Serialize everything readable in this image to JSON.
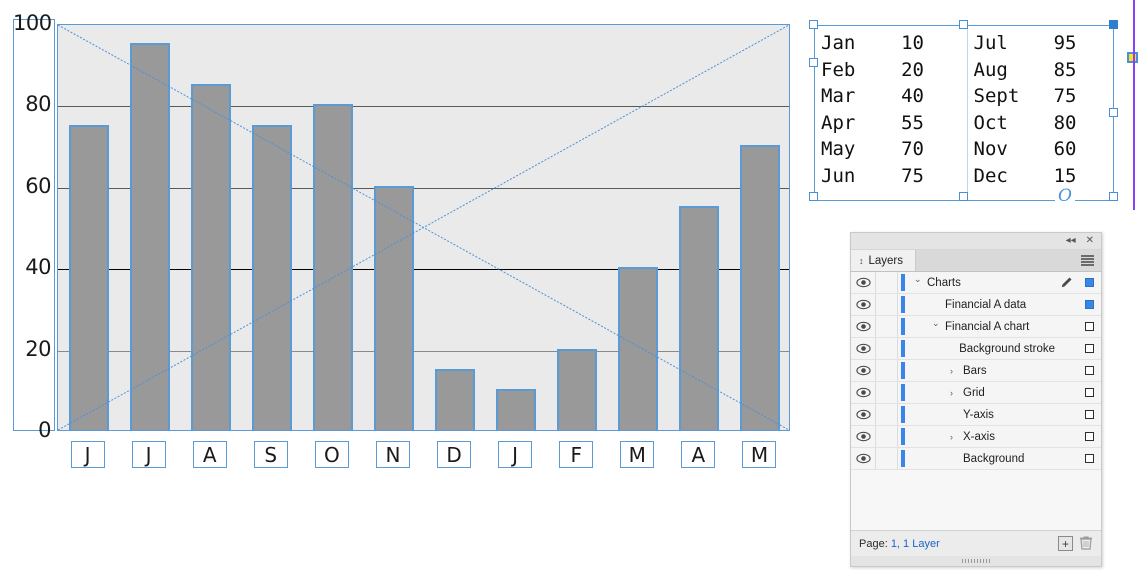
{
  "chart_data": {
    "type": "bar",
    "title": "",
    "xlabel": "",
    "ylabel": "",
    "ylim": [
      0,
      100
    ],
    "grid": true,
    "legend": "none",
    "categories": [
      "J",
      "J",
      "A",
      "S",
      "O",
      "N",
      "D",
      "J",
      "F",
      "M",
      "A",
      "M"
    ],
    "month_names": [
      "Jul",
      "Aug",
      "Sept",
      "Oct",
      "Nov",
      "Dec",
      "Jan",
      "Feb",
      "Mar",
      "Apr",
      "May",
      "Jun"
    ],
    "values": [
      75,
      95,
      85,
      75,
      80,
      60,
      15,
      10,
      20,
      40,
      55,
      70
    ],
    "ytick_labels": [
      "100",
      "80",
      "60",
      "40",
      "20",
      "0"
    ],
    "ytick_values": [
      100,
      80,
      60,
      40,
      20,
      0
    ],
    "gridline_values": [
      80,
      60,
      40,
      20
    ],
    "gridline_colors": [
      "#5a5a5a",
      "#5a5a5a",
      "#000000",
      "#8a8a8a"
    ],
    "bar_fill": "#999999",
    "bar_stroke": "#5b9bd5",
    "plot_background": "#eaeaea",
    "selection_color": "#4a90d9"
  },
  "data_frame": {
    "columns": [
      {
        "rows": [
          {
            "label": "Jan",
            "value": "10"
          },
          {
            "label": "Feb",
            "value": "20"
          },
          {
            "label": "Mar",
            "value": "40"
          },
          {
            "label": "Apr",
            "value": "55"
          },
          {
            "label": "May",
            "value": "70"
          },
          {
            "label": "Jun",
            "value": "75"
          }
        ]
      },
      {
        "rows": [
          {
            "label": "Jul",
            "value": "95"
          },
          {
            "label": "Aug",
            "value": "85"
          },
          {
            "label": "Sept",
            "value": "75"
          },
          {
            "label": "Oct",
            "value": "80"
          },
          {
            "label": "Nov",
            "value": "60"
          },
          {
            "label": "Dec",
            "value": "15"
          }
        ]
      }
    ],
    "lines": [
      "Jan    10",
      "Feb    20",
      "Mar    40",
      "Apr    55",
      "May    70",
      "Jun    75",
      "Jul    95",
      "Aug    85",
      "Sept   75",
      "Oct    80",
      "Nov    60",
      "Dec    15"
    ],
    "outport_glyph": "O"
  },
  "layers_panel": {
    "tab_label": "Layers",
    "tab_icon": "updown-arrows-icon",
    "collapse_icon": "◂◂",
    "close_icon": "✕",
    "menu_icon": "panel-menu-icon",
    "rows": [
      {
        "name": "Charts",
        "indent": 0,
        "disclosure": "open",
        "targeted": true,
        "extra_icon": "pencil",
        "visible": true
      },
      {
        "name": "Financial A data",
        "indent": 1,
        "disclosure": "none",
        "targeted": true,
        "extra_icon": "",
        "visible": true
      },
      {
        "name": "Financial A chart",
        "indent": 1,
        "disclosure": "open",
        "targeted": false,
        "extra_icon": "",
        "visible": true
      },
      {
        "name": "Background stroke",
        "indent": 2,
        "disclosure": "none",
        "targeted": false,
        "extra_icon": "",
        "visible": true
      },
      {
        "name": "Bars",
        "indent": 2,
        "disclosure": "closed",
        "targeted": false,
        "extra_icon": "",
        "visible": true
      },
      {
        "name": "Grid",
        "indent": 2,
        "disclosure": "closed",
        "targeted": false,
        "extra_icon": "",
        "visible": true
      },
      {
        "name": "Y-axis",
        "indent": 2,
        "disclosure": "none",
        "targeted": false,
        "extra_icon": "",
        "visible": true
      },
      {
        "name": "X-axis",
        "indent": 2,
        "disclosure": "closed",
        "targeted": false,
        "extra_icon": "",
        "visible": true
      },
      {
        "name": "Background",
        "indent": 2,
        "disclosure": "none",
        "targeted": false,
        "extra_icon": "",
        "visible": true
      }
    ],
    "footer_status": "Page: 1, 1 Layer",
    "footer_page_label": "Page:",
    "footer_page_num": "1",
    "footer_layer_count": "1 Layer",
    "add_layer_icon": "+",
    "delete_layer_icon": "trash-icon",
    "layer_color": "#3a86e8"
  }
}
